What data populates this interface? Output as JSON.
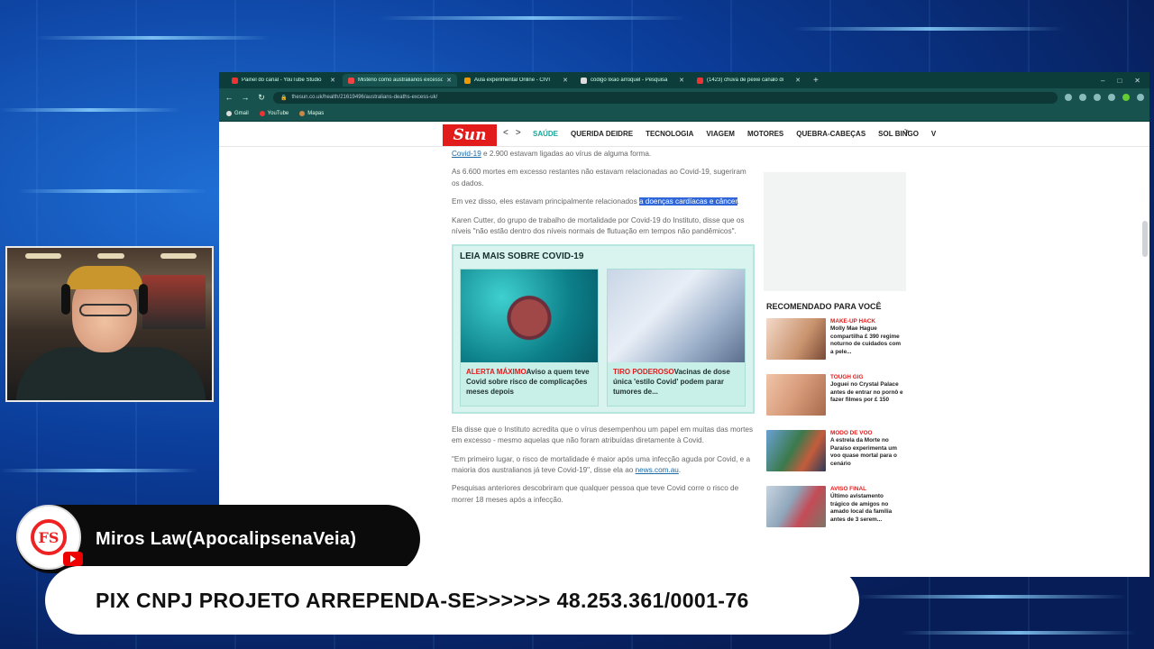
{
  "browser": {
    "tabs": [
      {
        "title": "Painel do canal - YouTube Studio",
        "active": false,
        "icon": "youtube-icon"
      },
      {
        "title": "Mistério como australianos excesso",
        "active": true,
        "icon": "sun-icon"
      },
      {
        "title": "Aula experimental Online - CIVI",
        "active": false,
        "icon": "orange-icon"
      },
      {
        "title": "código lixão arroquel - Pesquisa",
        "active": false,
        "icon": "google-icon"
      },
      {
        "title": "(1423) chuva de peixe canalo di",
        "active": false,
        "icon": "youtube-icon"
      }
    ],
    "new_tab": "+",
    "window_controls": [
      "–",
      "□",
      "✕"
    ],
    "url": "thesun.co.uk/health/21619496/australians-deaths-excess-uk/",
    "bookmarks": [
      {
        "label": "Gmail",
        "icon": "gmail-icon"
      },
      {
        "label": "YouTube",
        "icon": "youtube-icon"
      },
      {
        "label": "Mapas",
        "icon": "maps-icon"
      }
    ]
  },
  "site": {
    "logo": "Sun",
    "nav_prev": "<",
    "nav_next": ">",
    "nav_items": [
      "SAÚDE",
      "QUERIDA DEIDRE",
      "TECNOLOGIA",
      "VIAGEM",
      "MOTORES",
      "QUEBRA-CABEÇAS",
      "SOL BINGO",
      "V"
    ],
    "active_nav": "SAÚDE"
  },
  "article": {
    "p0_link": "Covid-19",
    "p0_rest": " e 2.900 estavam ligadas ao vírus de alguma forma.",
    "p1": "As 6.600 mortes em excesso restantes não estavam relacionadas ao Covid-19, sugeriram os dados.",
    "p2_pre": "Em vez disso, eles estavam principalmente relacionados ",
    "p2_highlight": "a doenças cardíacas e câncer",
    "p2_post": ".",
    "p3": "Karen Cutter, do grupo de trabalho de mortalidade por Covid-19 do Instituto, disse que os níveis \"não estão dentro dos níveis normais de flutuação em tempos não pandêmicos\".",
    "p4": "Ela disse que o Instituto acredita que o vírus desempenhou um papel em muitas das mortes em excesso - mesmo aquelas que não foram atribuídas diretamente à Covid.",
    "p5_pre": "\"Em primeiro lugar, o risco de mortalidade é maior após uma infecção aguda por Covid, e a maioria dos australianos já teve Covid-19\", disse ela ao ",
    "p5_link": "news.com.au",
    "p5_post": ".",
    "p6": "Pesquisas anteriores descobriram que qualquer pessoa que teve Covid corre o risco de morrer 18 meses após a infecção."
  },
  "read_more": {
    "heading": "LEIA MAIS SOBRE COVID-19",
    "cards": [
      {
        "kicker": "ALERTA MÁXIMO",
        "text": "Aviso a quem teve Covid sobre risco de complicações meses depois"
      },
      {
        "kicker": "TIRO PODEROSO",
        "text": "Vacinas de dose única 'estilo Covid' podem parar tumores de..."
      }
    ]
  },
  "recommended": {
    "heading": "RECOMENDADO PARA VOCÊ",
    "items": [
      {
        "kicker": "MAKE-UP HACK",
        "text": "Molly Mae Hague compartilha £ 390 regime noturno de cuidados com a pele..."
      },
      {
        "kicker": "TOUGH GIG",
        "text": "Joguei no Crystal Palace antes de entrar no pornô e fazer filmes por £ 150"
      },
      {
        "kicker": "MODO DE VOO",
        "text": "A estrela da Morte no Paraíso experimenta um voo quase mortal para o cenário"
      },
      {
        "kicker": "AVISO FINAL",
        "text": "Último avistamento trágico de amigos no amado local da família antes de 3 serem..."
      }
    ]
  },
  "stream": {
    "channel_name": "Miros Law(ApocalipsenaVeia)",
    "avatar_text": "FS",
    "pix_text": "PIX CNPJ PROJETO ARREPENDA-SE>>>>>> 48.253.361/0001-76"
  },
  "colors": {
    "sun_red": "#e21b1b",
    "accent_teal": "#1aa39a",
    "chrome_dark": "#0c3d3a",
    "highlight": "#2f67d8"
  }
}
